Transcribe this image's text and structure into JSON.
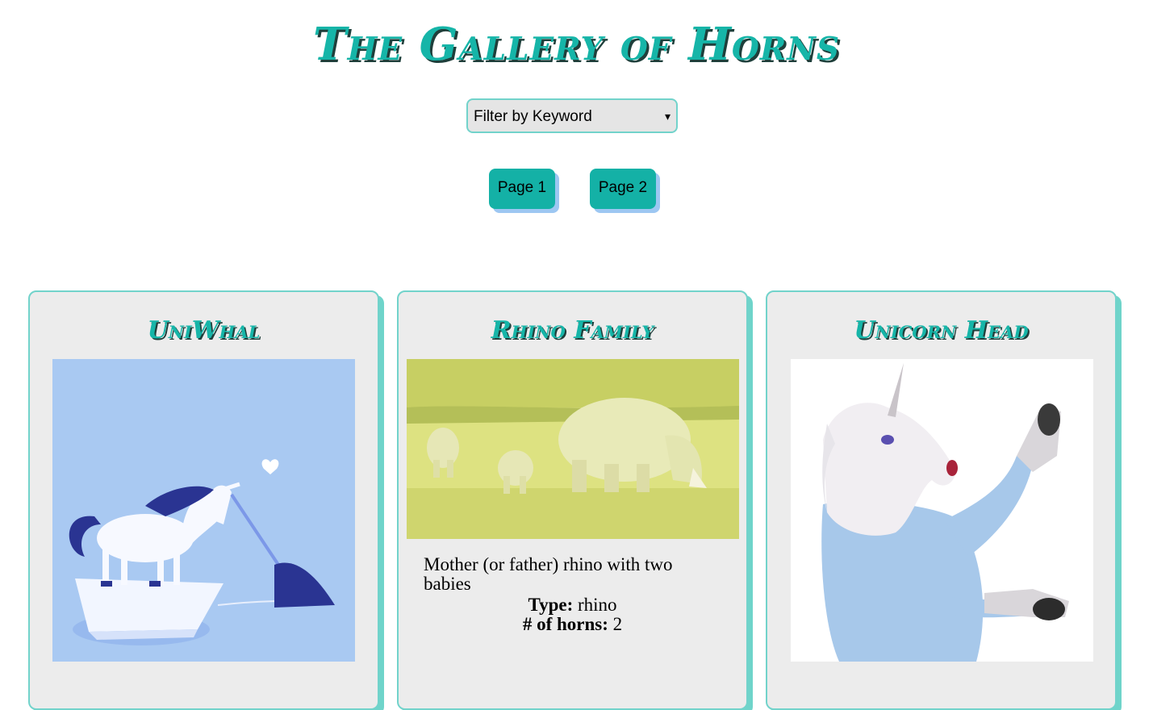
{
  "header": {
    "title": "The Gallery of Horns"
  },
  "filter": {
    "label": "Filter by Keyword",
    "caret": "▾"
  },
  "pagination": {
    "page1": "Page 1",
    "page2": "Page 2"
  },
  "cards": [
    {
      "title": "UniWhal"
    },
    {
      "title": "Rhino Family",
      "description": "Mother (or father) rhino with two babies",
      "type_label": "Type:",
      "type_value": "rhino",
      "horns_label": "# of horns:",
      "horns_value": "2"
    },
    {
      "title": "Unicorn Head"
    }
  ]
}
